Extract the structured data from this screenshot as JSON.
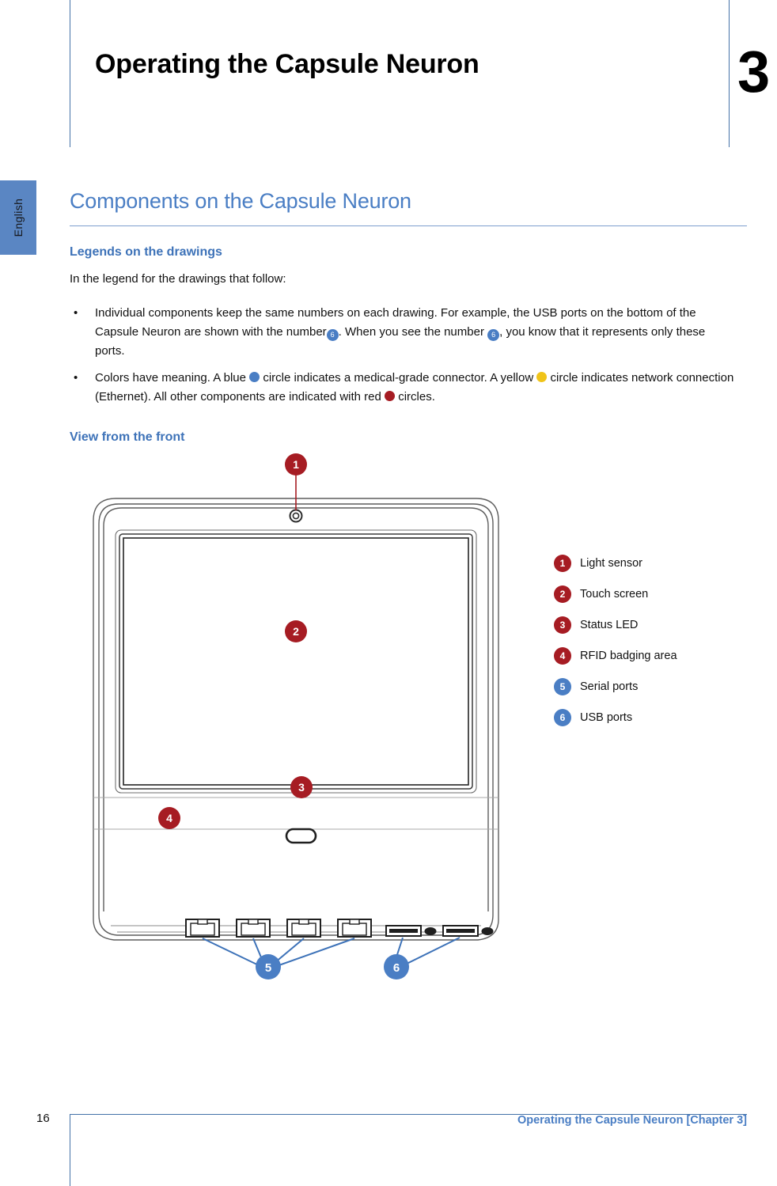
{
  "chapter": {
    "title": "Operating the Capsule Neuron",
    "number": "3"
  },
  "language_tab": {
    "label": "English"
  },
  "section": {
    "heading": "Components on the Capsule Neuron",
    "subheading_legends": "Legends on the drawings",
    "intro": "In the legend for the drawings that follow:",
    "subheading_view": "View from the front"
  },
  "bullets": [
    {
      "marker": "•",
      "part1": "Individual components keep the same numbers on each drawing. For example, the USB ports on the bottom of the Capsule Neuron are shown with the number",
      "badge1": "6",
      "part2": ". When you see the number",
      "badge2": "6",
      "part3": ", you know that it represents only these ports."
    },
    {
      "marker": "•",
      "part1": "Colors have meaning. A blue",
      "part2": "circle indicates a medical-grade connector. A yellow",
      "part3": "circle indicates network connection (Ethernet). All other components are indicated with red",
      "part4": "circles."
    }
  ],
  "legend": {
    "items": [
      {
        "number": "1",
        "label": "Light sensor",
        "color": "red"
      },
      {
        "number": "2",
        "label": "Touch screen",
        "color": "red"
      },
      {
        "number": "3",
        "label": "Status LED",
        "color": "red"
      },
      {
        "number": "4",
        "label": "RFID badging area",
        "color": "red"
      },
      {
        "number": "5",
        "label": "Serial ports",
        "color": "blue"
      },
      {
        "number": "6",
        "label": "USB ports",
        "color": "blue"
      }
    ]
  },
  "figure": {
    "callouts": [
      {
        "number": "1",
        "color": "red"
      },
      {
        "number": "2",
        "color": "red"
      },
      {
        "number": "3",
        "color": "red"
      },
      {
        "number": "4",
        "color": "red"
      },
      {
        "number": "5",
        "color": "blue"
      },
      {
        "number": "6",
        "color": "blue"
      }
    ]
  },
  "footer": {
    "page_number": "16",
    "text": "Operating the Capsule Neuron [Chapter 3]"
  },
  "colors": {
    "accent_blue": "#4a7ec4",
    "rule_blue": "#4472a8",
    "red": "#a61c23",
    "yellow": "#f0c419",
    "tab_blue": "#5a86c3"
  }
}
